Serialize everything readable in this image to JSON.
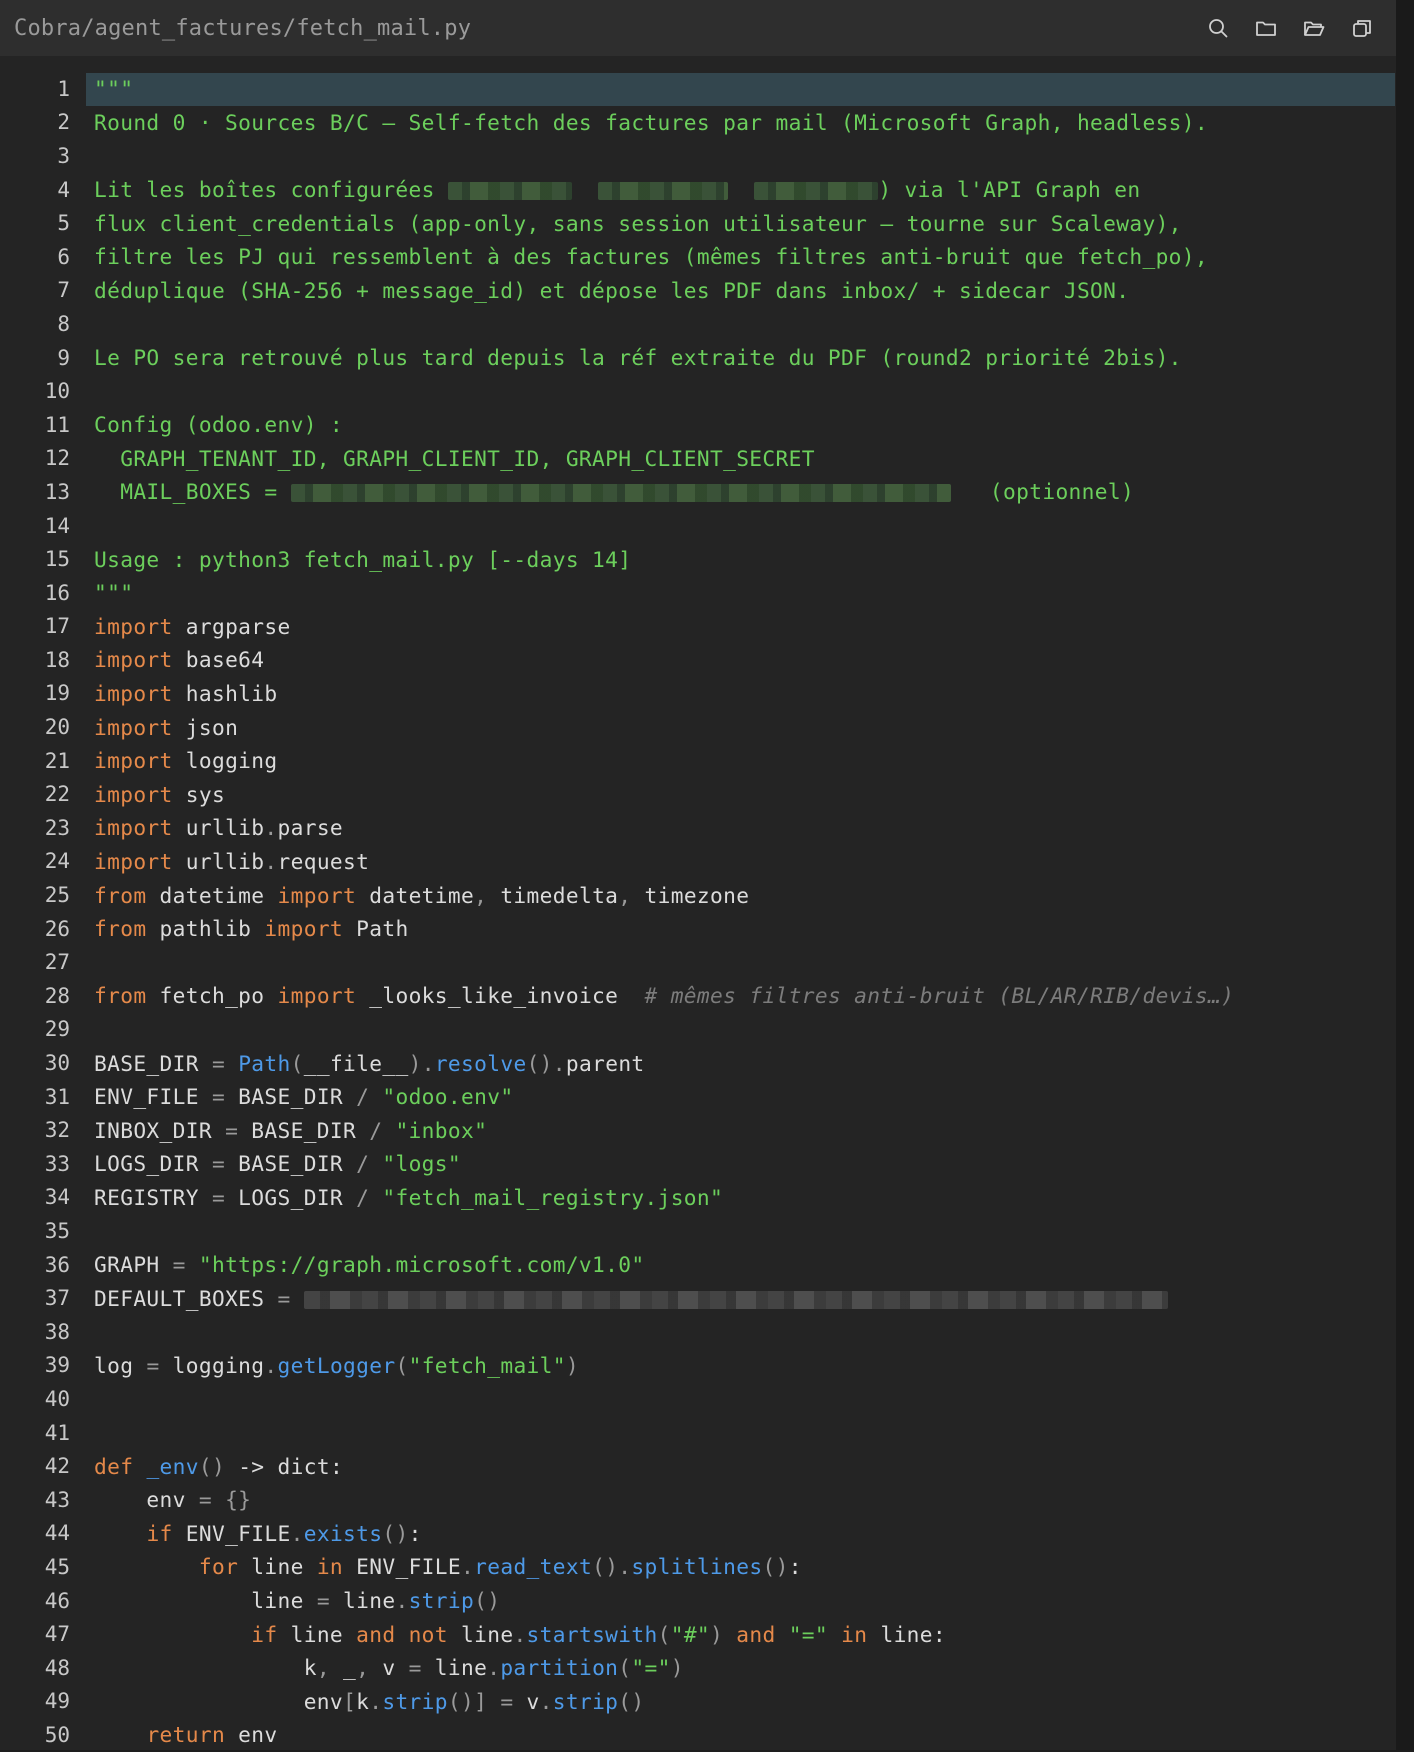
{
  "window": {
    "file_path": "Cobra/agent_factures/fetch_mail.py",
    "icons": [
      "search-icon",
      "folder-icon",
      "folder-open-icon",
      "copy-icon"
    ]
  },
  "editor": {
    "active_line": 1,
    "colors": {
      "background": "#242424",
      "docstring": "#6ccf5c",
      "keyword": "#e5894a",
      "function": "#4e9ae8",
      "comment": "#7c7c7c",
      "active_line": "#33464e"
    },
    "lines": [
      {
        "n": "1",
        "segs": [
          {
            "c": "doc",
            "t": "\"\"\""
          }
        ]
      },
      {
        "n": "2",
        "segs": [
          {
            "c": "doc",
            "t": "Round 0 · Sources B/C — Self-fetch des factures par mail (Microsoft Graph, headless)."
          }
        ]
      },
      {
        "n": "3",
        "segs": []
      },
      {
        "n": "4",
        "segs": [
          {
            "c": "doc",
            "t": "Lit les boîtes configurées "
          },
          {
            "blur": 124
          },
          {
            "c": "doc",
            "t": "  "
          },
          {
            "blur": 130
          },
          {
            "c": "doc",
            "t": "  "
          },
          {
            "blur": 124
          },
          {
            "c": "doc",
            "t": ") via l'API Graph en"
          }
        ]
      },
      {
        "n": "5",
        "segs": [
          {
            "c": "doc",
            "t": "flux client_credentials (app-only, sans session utilisateur — tourne sur Scaleway),"
          }
        ]
      },
      {
        "n": "6",
        "segs": [
          {
            "c": "doc",
            "t": "filtre les PJ qui ressemblent à des factures (mêmes filtres anti-bruit que fetch_po),"
          }
        ]
      },
      {
        "n": "7",
        "segs": [
          {
            "c": "doc",
            "t": "déduplique (SHA-256 + message_id) et dépose les PDF dans inbox/ + sidecar JSON."
          }
        ]
      },
      {
        "n": "8",
        "segs": []
      },
      {
        "n": "9",
        "segs": [
          {
            "c": "doc",
            "t": "Le PO sera retrouvé plus tard depuis la réf extraite du PDF (round2 priorité 2bis)."
          }
        ]
      },
      {
        "n": "10",
        "segs": []
      },
      {
        "n": "11",
        "segs": [
          {
            "c": "doc",
            "t": "Config (odoo.env) :"
          }
        ]
      },
      {
        "n": "12",
        "segs": [
          {
            "c": "doc",
            "t": "  GRAPH_TENANT_ID, GRAPH_CLIENT_ID, GRAPH_CLIENT_SECRET"
          }
        ]
      },
      {
        "n": "13",
        "segs": [
          {
            "c": "doc",
            "t": "  MAIL_BOXES = "
          },
          {
            "blur": 660
          },
          {
            "c": "doc",
            "t": "   (optionnel)"
          }
        ]
      },
      {
        "n": "14",
        "segs": []
      },
      {
        "n": "15",
        "segs": [
          {
            "c": "doc",
            "t": "Usage : python3 fetch_mail.py [--days 14]"
          }
        ]
      },
      {
        "n": "16",
        "segs": [
          {
            "c": "doc",
            "t": "\"\"\""
          }
        ]
      },
      {
        "n": "17",
        "segs": [
          {
            "c": "kw",
            "t": "import"
          },
          {
            "t": " argparse"
          }
        ]
      },
      {
        "n": "18",
        "segs": [
          {
            "c": "kw",
            "t": "import"
          },
          {
            "t": " base64"
          }
        ]
      },
      {
        "n": "19",
        "segs": [
          {
            "c": "kw",
            "t": "import"
          },
          {
            "t": " hashlib"
          }
        ]
      },
      {
        "n": "20",
        "segs": [
          {
            "c": "kw",
            "t": "import"
          },
          {
            "t": " json"
          }
        ]
      },
      {
        "n": "21",
        "segs": [
          {
            "c": "kw",
            "t": "import"
          },
          {
            "t": " logging"
          }
        ]
      },
      {
        "n": "22",
        "segs": [
          {
            "c": "kw",
            "t": "import"
          },
          {
            "t": " sys"
          }
        ]
      },
      {
        "n": "23",
        "segs": [
          {
            "c": "kw",
            "t": "import"
          },
          {
            "t": " urllib"
          },
          {
            "c": "op",
            "t": "."
          },
          {
            "t": "parse"
          }
        ]
      },
      {
        "n": "24",
        "segs": [
          {
            "c": "kw",
            "t": "import"
          },
          {
            "t": " urllib"
          },
          {
            "c": "op",
            "t": "."
          },
          {
            "t": "request"
          }
        ]
      },
      {
        "n": "25",
        "segs": [
          {
            "c": "kw",
            "t": "from"
          },
          {
            "t": " datetime "
          },
          {
            "c": "kw",
            "t": "import"
          },
          {
            "t": " datetime"
          },
          {
            "c": "op",
            "t": ","
          },
          {
            "t": " timedelta"
          },
          {
            "c": "op",
            "t": ","
          },
          {
            "t": " timezone"
          }
        ]
      },
      {
        "n": "26",
        "segs": [
          {
            "c": "kw",
            "t": "from"
          },
          {
            "t": " pathlib "
          },
          {
            "c": "kw",
            "t": "import"
          },
          {
            "t": " Path"
          }
        ]
      },
      {
        "n": "27",
        "segs": []
      },
      {
        "n": "28",
        "segs": [
          {
            "c": "kw",
            "t": "from"
          },
          {
            "t": " fetch_po "
          },
          {
            "c": "kw",
            "t": "import"
          },
          {
            "t": " _looks_like_invoice  "
          },
          {
            "c": "cm",
            "t": "# mêmes filtres anti-bruit (BL/AR/RIB/devis…)"
          }
        ]
      },
      {
        "n": "29",
        "segs": []
      },
      {
        "n": "30",
        "segs": [
          {
            "t": "BASE_DIR "
          },
          {
            "c": "op",
            "t": "="
          },
          {
            "t": " "
          },
          {
            "c": "fn",
            "t": "Path"
          },
          {
            "c": "op",
            "t": "("
          },
          {
            "t": "__file__"
          },
          {
            "c": "op",
            "t": ")."
          },
          {
            "c": "fn",
            "t": "resolve"
          },
          {
            "c": "op",
            "t": "()."
          },
          {
            "t": "parent"
          }
        ]
      },
      {
        "n": "31",
        "segs": [
          {
            "t": "ENV_FILE "
          },
          {
            "c": "op",
            "t": "="
          },
          {
            "t": " BASE_DIR "
          },
          {
            "c": "op",
            "t": "/"
          },
          {
            "t": " "
          },
          {
            "c": "st",
            "t": "\"odoo.env\""
          }
        ]
      },
      {
        "n": "32",
        "segs": [
          {
            "t": "INBOX_DIR "
          },
          {
            "c": "op",
            "t": "="
          },
          {
            "t": " BASE_DIR "
          },
          {
            "c": "op",
            "t": "/"
          },
          {
            "t": " "
          },
          {
            "c": "st",
            "t": "\"inbox\""
          }
        ]
      },
      {
        "n": "33",
        "segs": [
          {
            "t": "LOGS_DIR "
          },
          {
            "c": "op",
            "t": "="
          },
          {
            "t": " BASE_DIR "
          },
          {
            "c": "op",
            "t": "/"
          },
          {
            "t": " "
          },
          {
            "c": "st",
            "t": "\"logs\""
          }
        ]
      },
      {
        "n": "34",
        "segs": [
          {
            "t": "REGISTRY "
          },
          {
            "c": "op",
            "t": "="
          },
          {
            "t": " LOGS_DIR "
          },
          {
            "c": "op",
            "t": "/"
          },
          {
            "t": " "
          },
          {
            "c": "st",
            "t": "\"fetch_mail_registry.json\""
          }
        ]
      },
      {
        "n": "35",
        "segs": []
      },
      {
        "n": "36",
        "segs": [
          {
            "t": "GRAPH "
          },
          {
            "c": "op",
            "t": "="
          },
          {
            "t": " "
          },
          {
            "c": "st",
            "t": "\"https://graph.microsoft.com/v1.0\""
          }
        ]
      },
      {
        "n": "37",
        "segs": [
          {
            "t": "DEFAULT_BOXES "
          },
          {
            "c": "op",
            "t": "="
          },
          {
            "t": " "
          },
          {
            "blur": 864,
            "grey": true
          }
        ]
      },
      {
        "n": "38",
        "segs": []
      },
      {
        "n": "39",
        "segs": [
          {
            "t": "log "
          },
          {
            "c": "op",
            "t": "="
          },
          {
            "t": " logging"
          },
          {
            "c": "op",
            "t": "."
          },
          {
            "c": "fn",
            "t": "getLogger"
          },
          {
            "c": "op",
            "t": "("
          },
          {
            "c": "st",
            "t": "\"fetch_mail\""
          },
          {
            "c": "op",
            "t": ")"
          }
        ]
      },
      {
        "n": "40",
        "segs": []
      },
      {
        "n": "41",
        "segs": []
      },
      {
        "n": "42",
        "segs": [
          {
            "c": "kw",
            "t": "def"
          },
          {
            "t": " "
          },
          {
            "c": "fn",
            "t": "_env"
          },
          {
            "c": "op",
            "t": "()"
          },
          {
            "t": " -> dict:"
          }
        ]
      },
      {
        "n": "43",
        "segs": [
          {
            "t": "    env "
          },
          {
            "c": "op",
            "t": "="
          },
          {
            "t": " "
          },
          {
            "c": "op",
            "t": "{}"
          }
        ]
      },
      {
        "n": "44",
        "segs": [
          {
            "t": "    "
          },
          {
            "c": "kw",
            "t": "if"
          },
          {
            "t": " ENV_FILE"
          },
          {
            "c": "op",
            "t": "."
          },
          {
            "c": "fn",
            "t": "exists"
          },
          {
            "c": "op",
            "t": "()"
          },
          {
            "t": ":"
          }
        ]
      },
      {
        "n": "45",
        "segs": [
          {
            "t": "        "
          },
          {
            "c": "kw",
            "t": "for"
          },
          {
            "t": " line "
          },
          {
            "c": "kw",
            "t": "in"
          },
          {
            "t": " ENV_FILE"
          },
          {
            "c": "op",
            "t": "."
          },
          {
            "c": "fn",
            "t": "read_text"
          },
          {
            "c": "op",
            "t": "()."
          },
          {
            "c": "fn",
            "t": "splitlines"
          },
          {
            "c": "op",
            "t": "()"
          },
          {
            "t": ":"
          }
        ]
      },
      {
        "n": "46",
        "segs": [
          {
            "t": "            line "
          },
          {
            "c": "op",
            "t": "="
          },
          {
            "t": " line"
          },
          {
            "c": "op",
            "t": "."
          },
          {
            "c": "fn",
            "t": "strip"
          },
          {
            "c": "op",
            "t": "()"
          }
        ]
      },
      {
        "n": "47",
        "segs": [
          {
            "t": "            "
          },
          {
            "c": "kw",
            "t": "if"
          },
          {
            "t": " line "
          },
          {
            "c": "kw",
            "t": "and"
          },
          {
            "t": " "
          },
          {
            "c": "kw",
            "t": "not"
          },
          {
            "t": " line"
          },
          {
            "c": "op",
            "t": "."
          },
          {
            "c": "fn",
            "t": "startswith"
          },
          {
            "c": "op",
            "t": "("
          },
          {
            "c": "st",
            "t": "\"#\""
          },
          {
            "c": "op",
            "t": ")"
          },
          {
            "t": " "
          },
          {
            "c": "kw",
            "t": "and"
          },
          {
            "t": " "
          },
          {
            "c": "st",
            "t": "\"=\""
          },
          {
            "t": " "
          },
          {
            "c": "kw",
            "t": "in"
          },
          {
            "t": " line:"
          }
        ]
      },
      {
        "n": "48",
        "segs": [
          {
            "t": "                k"
          },
          {
            "c": "op",
            "t": ","
          },
          {
            "t": " _"
          },
          {
            "c": "op",
            "t": ","
          },
          {
            "t": " v "
          },
          {
            "c": "op",
            "t": "="
          },
          {
            "t": " line"
          },
          {
            "c": "op",
            "t": "."
          },
          {
            "c": "fn",
            "t": "partition"
          },
          {
            "c": "op",
            "t": "("
          },
          {
            "c": "st",
            "t": "\"=\""
          },
          {
            "c": "op",
            "t": ")"
          }
        ]
      },
      {
        "n": "49",
        "segs": [
          {
            "t": "                env"
          },
          {
            "c": "op",
            "t": "["
          },
          {
            "t": "k"
          },
          {
            "c": "op",
            "t": "."
          },
          {
            "c": "fn",
            "t": "strip"
          },
          {
            "c": "op",
            "t": "()]"
          },
          {
            "t": " "
          },
          {
            "c": "op",
            "t": "="
          },
          {
            "t": " v"
          },
          {
            "c": "op",
            "t": "."
          },
          {
            "c": "fn",
            "t": "strip"
          },
          {
            "c": "op",
            "t": "()"
          }
        ]
      },
      {
        "n": "50",
        "segs": [
          {
            "t": "    "
          },
          {
            "c": "kw",
            "t": "return"
          },
          {
            "t": " env"
          }
        ]
      }
    ]
  }
}
